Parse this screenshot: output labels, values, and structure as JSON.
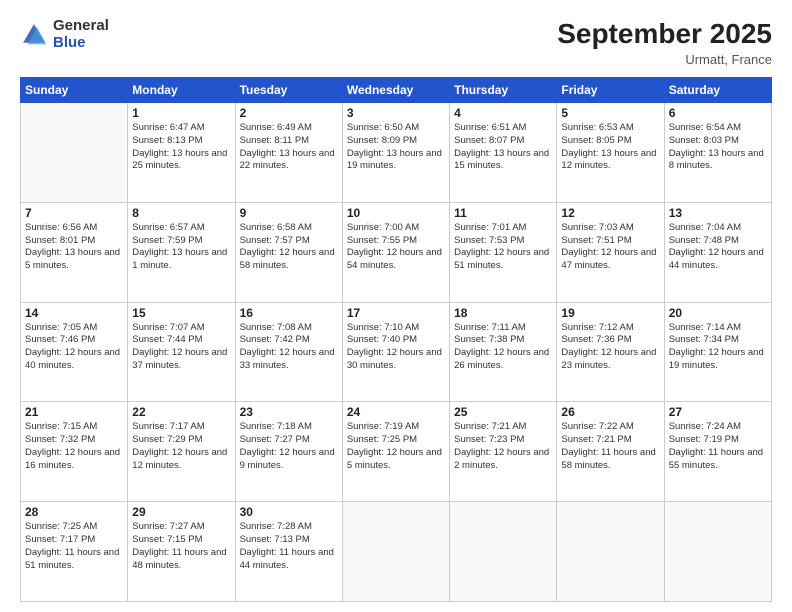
{
  "logo": {
    "general": "General",
    "blue": "Blue"
  },
  "header": {
    "month": "September 2025",
    "location": "Urmatt, France"
  },
  "weekdays": [
    "Sunday",
    "Monday",
    "Tuesday",
    "Wednesday",
    "Thursday",
    "Friday",
    "Saturday"
  ],
  "weeks": [
    [
      {
        "day": null
      },
      {
        "day": 1,
        "sunrise": "6:47 AM",
        "sunset": "8:13 PM",
        "daylight": "13 hours and 25 minutes."
      },
      {
        "day": 2,
        "sunrise": "6:49 AM",
        "sunset": "8:11 PM",
        "daylight": "13 hours and 22 minutes."
      },
      {
        "day": 3,
        "sunrise": "6:50 AM",
        "sunset": "8:09 PM",
        "daylight": "13 hours and 19 minutes."
      },
      {
        "day": 4,
        "sunrise": "6:51 AM",
        "sunset": "8:07 PM",
        "daylight": "13 hours and 15 minutes."
      },
      {
        "day": 5,
        "sunrise": "6:53 AM",
        "sunset": "8:05 PM",
        "daylight": "13 hours and 12 minutes."
      },
      {
        "day": 6,
        "sunrise": "6:54 AM",
        "sunset": "8:03 PM",
        "daylight": "13 hours and 8 minutes."
      }
    ],
    [
      {
        "day": 7,
        "sunrise": "6:56 AM",
        "sunset": "8:01 PM",
        "daylight": "13 hours and 5 minutes."
      },
      {
        "day": 8,
        "sunrise": "6:57 AM",
        "sunset": "7:59 PM",
        "daylight": "13 hours and 1 minute."
      },
      {
        "day": 9,
        "sunrise": "6:58 AM",
        "sunset": "7:57 PM",
        "daylight": "12 hours and 58 minutes."
      },
      {
        "day": 10,
        "sunrise": "7:00 AM",
        "sunset": "7:55 PM",
        "daylight": "12 hours and 54 minutes."
      },
      {
        "day": 11,
        "sunrise": "7:01 AM",
        "sunset": "7:53 PM",
        "daylight": "12 hours and 51 minutes."
      },
      {
        "day": 12,
        "sunrise": "7:03 AM",
        "sunset": "7:51 PM",
        "daylight": "12 hours and 47 minutes."
      },
      {
        "day": 13,
        "sunrise": "7:04 AM",
        "sunset": "7:48 PM",
        "daylight": "12 hours and 44 minutes."
      }
    ],
    [
      {
        "day": 14,
        "sunrise": "7:05 AM",
        "sunset": "7:46 PM",
        "daylight": "12 hours and 40 minutes."
      },
      {
        "day": 15,
        "sunrise": "7:07 AM",
        "sunset": "7:44 PM",
        "daylight": "12 hours and 37 minutes."
      },
      {
        "day": 16,
        "sunrise": "7:08 AM",
        "sunset": "7:42 PM",
        "daylight": "12 hours and 33 minutes."
      },
      {
        "day": 17,
        "sunrise": "7:10 AM",
        "sunset": "7:40 PM",
        "daylight": "12 hours and 30 minutes."
      },
      {
        "day": 18,
        "sunrise": "7:11 AM",
        "sunset": "7:38 PM",
        "daylight": "12 hours and 26 minutes."
      },
      {
        "day": 19,
        "sunrise": "7:12 AM",
        "sunset": "7:36 PM",
        "daylight": "12 hours and 23 minutes."
      },
      {
        "day": 20,
        "sunrise": "7:14 AM",
        "sunset": "7:34 PM",
        "daylight": "12 hours and 19 minutes."
      }
    ],
    [
      {
        "day": 21,
        "sunrise": "7:15 AM",
        "sunset": "7:32 PM",
        "daylight": "12 hours and 16 minutes."
      },
      {
        "day": 22,
        "sunrise": "7:17 AM",
        "sunset": "7:29 PM",
        "daylight": "12 hours and 12 minutes."
      },
      {
        "day": 23,
        "sunrise": "7:18 AM",
        "sunset": "7:27 PM",
        "daylight": "12 hours and 9 minutes."
      },
      {
        "day": 24,
        "sunrise": "7:19 AM",
        "sunset": "7:25 PM",
        "daylight": "12 hours and 5 minutes."
      },
      {
        "day": 25,
        "sunrise": "7:21 AM",
        "sunset": "7:23 PM",
        "daylight": "12 hours and 2 minutes."
      },
      {
        "day": 26,
        "sunrise": "7:22 AM",
        "sunset": "7:21 PM",
        "daylight": "11 hours and 58 minutes."
      },
      {
        "day": 27,
        "sunrise": "7:24 AM",
        "sunset": "7:19 PM",
        "daylight": "11 hours and 55 minutes."
      }
    ],
    [
      {
        "day": 28,
        "sunrise": "7:25 AM",
        "sunset": "7:17 PM",
        "daylight": "11 hours and 51 minutes."
      },
      {
        "day": 29,
        "sunrise": "7:27 AM",
        "sunset": "7:15 PM",
        "daylight": "11 hours and 48 minutes."
      },
      {
        "day": 30,
        "sunrise": "7:28 AM",
        "sunset": "7:13 PM",
        "daylight": "11 hours and 44 minutes."
      },
      {
        "day": null
      },
      {
        "day": null
      },
      {
        "day": null
      },
      {
        "day": null
      }
    ]
  ]
}
